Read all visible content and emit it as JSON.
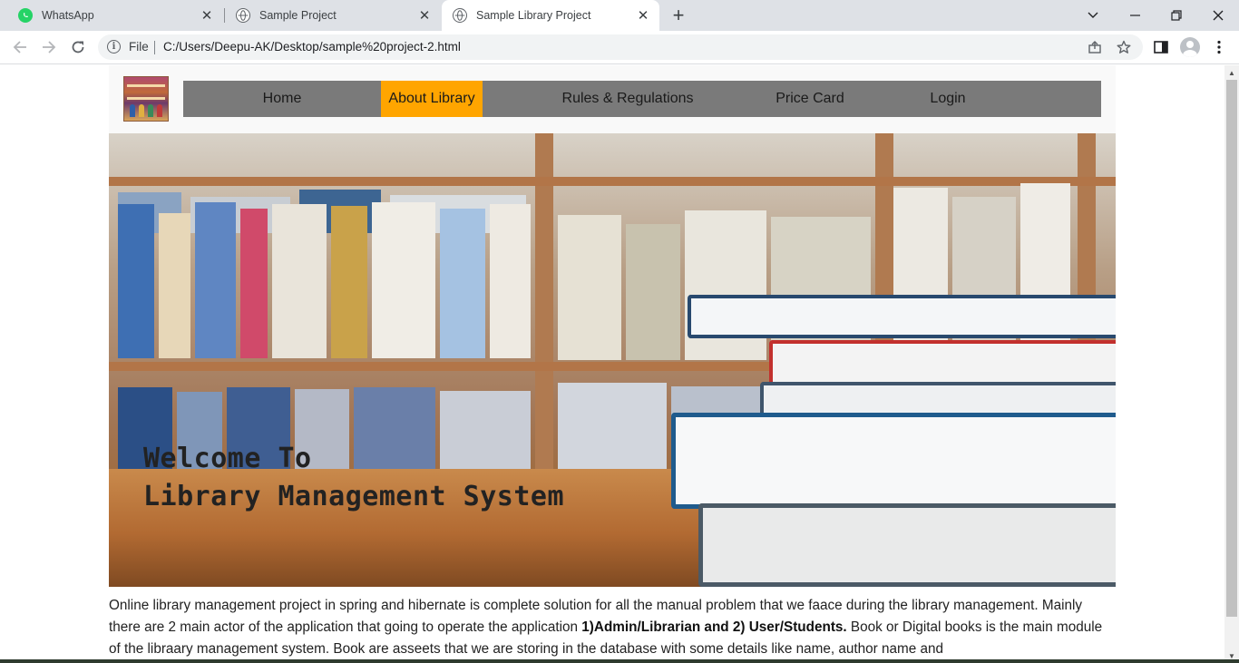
{
  "browser": {
    "tabs": [
      {
        "title": "WhatsApp",
        "icon": "whatsapp-icon",
        "active": false
      },
      {
        "title": "Sample Project",
        "icon": "globe-icon",
        "active": false
      },
      {
        "title": "Sample Library Project",
        "icon": "globe-icon",
        "active": true
      }
    ],
    "address": {
      "scheme_label": "File",
      "url": "C:/Users/Deepu-AK/Desktop/sample%20project-2.html"
    }
  },
  "site": {
    "nav": [
      {
        "label": "Home",
        "active": false
      },
      {
        "label": "About Library",
        "active": true
      },
      {
        "label": "Rules & Regulations",
        "active": false
      },
      {
        "label": "Price Card",
        "active": false
      },
      {
        "label": "Login",
        "active": false
      }
    ],
    "hero": {
      "line1": "Welcome To",
      "line2": "Library Management System"
    },
    "description": {
      "part1": "Online library management project in spring and hibernate is complete solution for all the manual problem that we faace during the library management. Mainly there are 2 main actor of the application that going to operate the application ",
      "bold": "1)Admin/Librarian and 2) User/Students.",
      "part2": " Book or Digital books is the main module of the libraary management system. Book are asseets that we are storing in the database with some details like name, author name and"
    }
  },
  "colors": {
    "nav_bg": "#7a7a7a",
    "nav_active": "#ffa500",
    "tabstrip_bg": "#dee1e6"
  }
}
